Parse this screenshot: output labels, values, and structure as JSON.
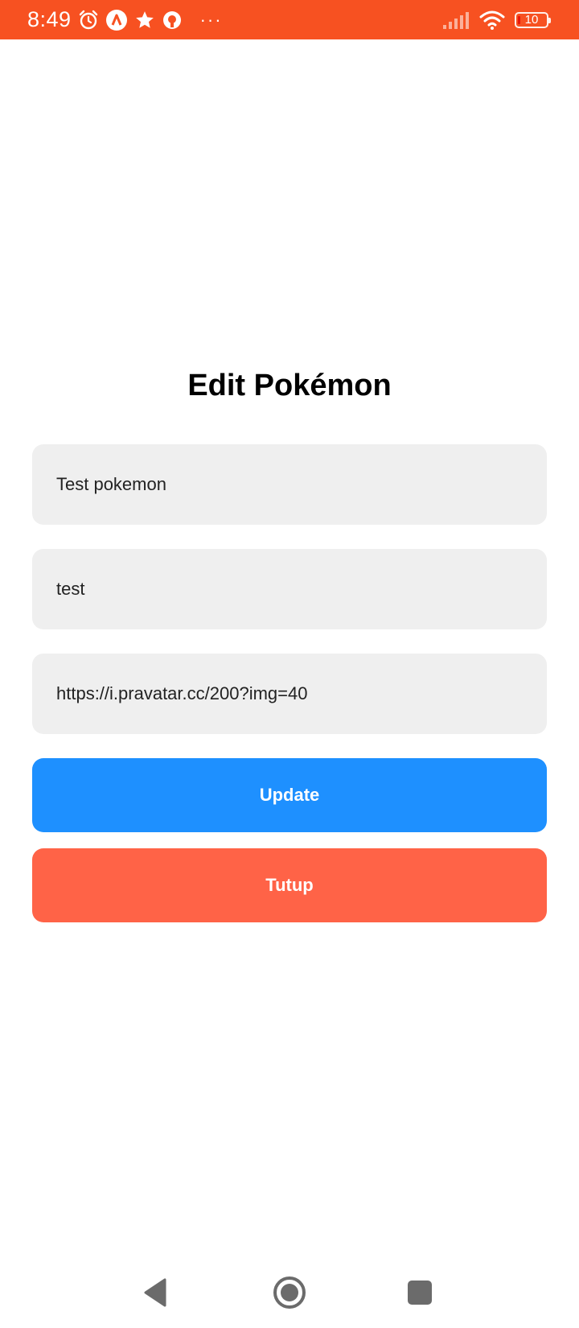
{
  "status_bar": {
    "time": "8:49",
    "battery": "10",
    "more": "···",
    "colors": {
      "background": "#f75121"
    },
    "icons": [
      "alarm-icon",
      "app-a-icon",
      "star-icon",
      "app-circle-icon",
      "more-icon",
      "signal-icon",
      "wifi-icon",
      "battery-icon"
    ]
  },
  "form": {
    "title": "Edit Pokémon",
    "fields": [
      {
        "value": "Test pokemon"
      },
      {
        "value": "test"
      },
      {
        "value": "https://i.pravatar.cc/200?img=40"
      }
    ],
    "field_background": "#efefef"
  },
  "buttons": {
    "update_label": "Update",
    "update_color": "#1e90ff",
    "close_label": "Tutup",
    "close_color": "#ff6347"
  },
  "nav_bar": {
    "icons": [
      "back-icon",
      "home-icon",
      "recents-icon"
    ]
  }
}
